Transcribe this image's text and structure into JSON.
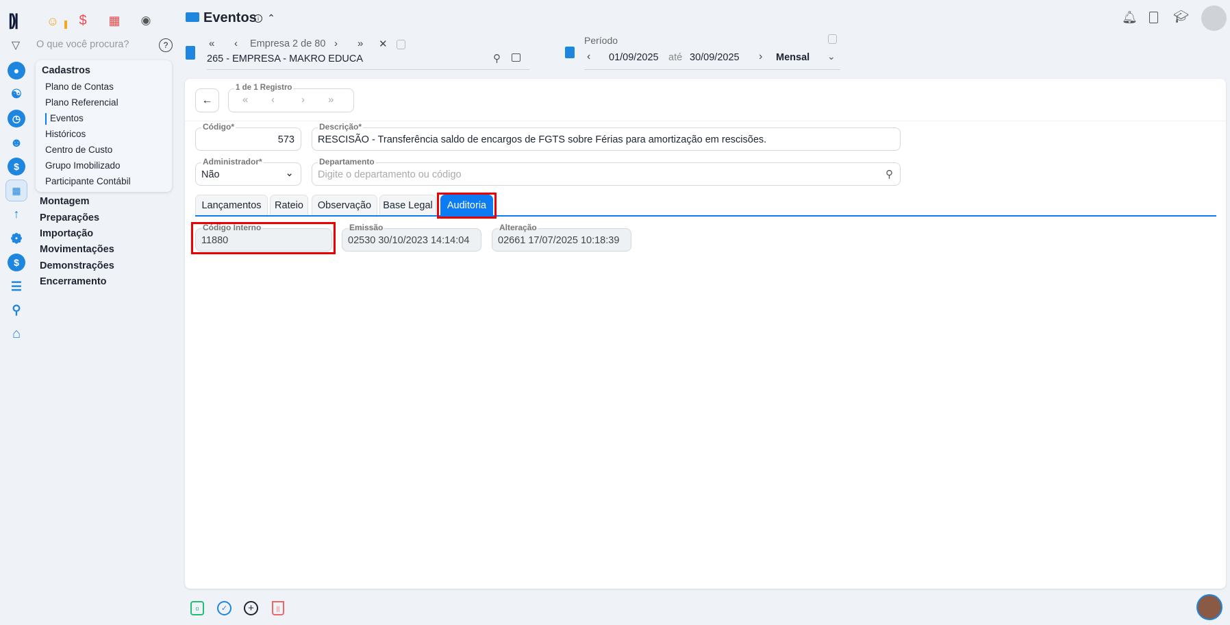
{
  "header": {
    "title": "Eventos"
  },
  "search": {
    "placeholder": "O que você procura?"
  },
  "company": {
    "nav_label": "Empresa 2 de 80",
    "name": "265 - EMPRESA - MAKRO EDUCA"
  },
  "period": {
    "label": "Período",
    "from": "01/09/2025",
    "sep": "até",
    "to": "30/09/2025",
    "mode": "Mensal"
  },
  "menu": {
    "title": "Cadastros",
    "items": [
      "Plano de Contas",
      "Plano Referencial",
      "Eventos",
      "Históricos",
      "Centro de Custo",
      "Grupo Imobilizado",
      "Participante Contábil"
    ],
    "sections": [
      "Montagem",
      "Preparações",
      "Importação",
      "Movimentações",
      "Demonstrações",
      "Encerramento"
    ]
  },
  "record": {
    "nav_label": "1 de 1 Registro"
  },
  "form": {
    "codigo": {
      "label": "Código*",
      "value": "573"
    },
    "descricao": {
      "label": "Descrição*",
      "value": "RESCISÃO - Transferência saldo de encargos de FGTS sobre Férias para amortização em rescisões."
    },
    "administrador": {
      "label": "Administrador*",
      "value": "Não"
    },
    "departamento": {
      "label": "Departamento",
      "placeholder": "Digite o departamento ou código"
    }
  },
  "tabs": [
    "Lançamentos",
    "Rateio",
    "Observação",
    "Base Legal",
    "Auditoria"
  ],
  "audit": {
    "codigo_interno": {
      "label": "Código Interno",
      "value": "11880"
    },
    "emissao": {
      "label": "Emissão",
      "value": "02530 30/10/2023 14:14:04"
    },
    "alteracao": {
      "label": "Alteração",
      "value": "02661 17/07/2025 10:18:39"
    }
  },
  "colors": {
    "accent": "#0d7cf2",
    "highlight": "#ee0000"
  }
}
